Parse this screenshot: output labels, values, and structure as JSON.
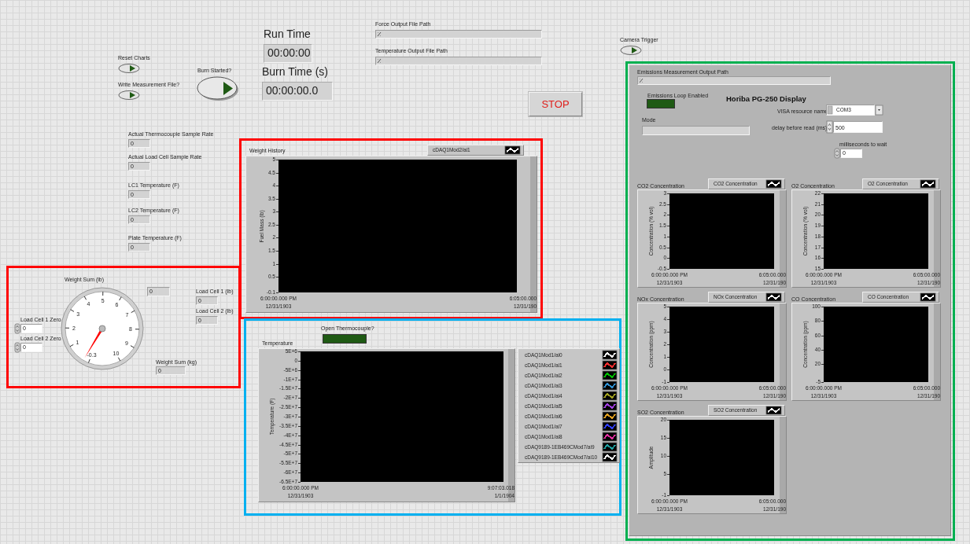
{
  "switches": [
    {
      "label": "Reset Charts",
      "on": false
    },
    {
      "label": "Write Measurement File?",
      "on": false
    },
    {
      "label": "Camera Trigger",
      "on": false
    }
  ],
  "burn_button": {
    "label": "Burn Started?",
    "on": false
  },
  "timers": [
    {
      "label": "Run Time",
      "value": "00:00:00"
    },
    {
      "label": "Burn Time (s)",
      "value": "00:00:00.0"
    }
  ],
  "file_paths": [
    {
      "label": "Force Output File Path"
    },
    {
      "label": "Temperature Output File Path"
    }
  ],
  "stop_button": "STOP",
  "indicators": [
    {
      "label": "Actual Thermocouple Sample Rate",
      "value": "0"
    },
    {
      "label": "Actual Load Cell Sample Rate",
      "value": "0"
    },
    {
      "label": "LC1 Temperature (F)",
      "value": "0"
    },
    {
      "label": "LC2 Temperature (F)",
      "value": "0"
    },
    {
      "label": "Plate Temperature (F)",
      "value": "0"
    }
  ],
  "weight_panel": {
    "gauge": {
      "label": "Weight Sum (lb)",
      "scale": [
        "-0.3",
        "1",
        "2",
        "3",
        "4",
        "5",
        "6",
        "7",
        "8",
        "9",
        "10"
      ]
    },
    "gauge_readout": "0",
    "load_cells": [
      {
        "label": "Load Cell 1 (lb)",
        "value": "0"
      },
      {
        "label": "Load Cell 2 (lb)",
        "value": "0"
      }
    ],
    "zeros": [
      {
        "label": "Load Cell 1 Zero",
        "value": "0"
      },
      {
        "label": "Load Cell 2 Zero",
        "value": "0"
      }
    ],
    "weight_kg": {
      "label": "Weight Sum (kg)",
      "value": "0"
    }
  },
  "weight_history": {
    "title": "Weight History",
    "legend": "cDAQ1Mod2/ai1",
    "ylabel": "Fuel Mass (lb)",
    "yticks": [
      "5",
      "4.5",
      "4",
      "3.5",
      "3",
      "2.5",
      "2",
      "1.5",
      "1",
      "0.5",
      "-0.1"
    ],
    "x_start": [
      "6:00:00.000 PM",
      "12/31/1903"
    ],
    "x_end": [
      "6:05:00.000",
      "12/31/190"
    ]
  },
  "open_thermocouple": {
    "label": "Open Thermocouple?",
    "on": false
  },
  "temperature_chart": {
    "title": "Temperature",
    "ylabel": "Temperature (F)",
    "yticks": [
      "5E+6",
      "0",
      "-5E+6",
      "-1E+7",
      "-1.5E+7",
      "-2E+7",
      "-2.5E+7",
      "-3E+7",
      "-3.5E+7",
      "-4E+7",
      "-4.5E+7",
      "-5E+7",
      "-5.5E+7",
      "-6E+7",
      "-6.5E+7"
    ],
    "x_start": [
      "6:00:00.000 PM",
      "12/31/1903"
    ],
    "x_end": [
      "9:07:03.018",
      "1/1/1904"
    ],
    "legend": [
      {
        "name": "cDAQ1Mod1/ai0",
        "color": "#ffffff"
      },
      {
        "name": "cDAQ1Mod1/ai1",
        "color": "#ff3030"
      },
      {
        "name": "cDAQ1Mod1/ai2",
        "color": "#00c000"
      },
      {
        "name": "cDAQ1Mod1/ai3",
        "color": "#3090d0"
      },
      {
        "name": "cDAQ1Mod1/ai4",
        "color": "#a0a020"
      },
      {
        "name": "cDAQ1Mod1/ai5",
        "color": "#a040e0"
      },
      {
        "name": "cDAQ1Mod1/ai6",
        "color": "#e0a020"
      },
      {
        "name": "cDAQ1Mod1/ai7",
        "color": "#3040ff"
      },
      {
        "name": "cDAQ1Mod1/ai8",
        "color": "#e030a0"
      },
      {
        "name": "cDAQ9189-1EB469CMod7/ai9",
        "color": "#20a0a0"
      },
      {
        "name": "cDAQ9189-1EB469CMod7/ai10",
        "color": "#ffffff"
      }
    ]
  },
  "emissions": {
    "path_label": "Emissions Measurement Output Path",
    "loop": {
      "label": "Emissions Loop Enabled",
      "on": false
    },
    "heading": "Horiba PG-250 Display",
    "mode_label": "Mode",
    "visa": {
      "label": "VISA resource name",
      "value": "COM3"
    },
    "delay": {
      "label": "delay before read (ms)",
      "value": "500"
    },
    "wait": {
      "label": "milliseconds to wait",
      "value": "0"
    },
    "charts": [
      {
        "title": "CO2 Concentration",
        "legend": "CO2 Concentration",
        "ylabel": "Concentration (% vol)",
        "yticks": [
          "3",
          "2.5",
          "2",
          "1.5",
          "1",
          "0.5",
          "0",
          "-0.5"
        ],
        "x_start": [
          "6:00:00.000 PM",
          "12/31/1903"
        ],
        "x_end": [
          "6:05:00.000",
          "12/31/190"
        ]
      },
      {
        "title": "O2 Concentration",
        "legend": "O2 Concentration",
        "ylabel": "Concentration (% vol)",
        "yticks": [
          "22",
          "21",
          "20",
          "19",
          "18",
          "17",
          "16",
          "15"
        ],
        "x_start": [
          "6:00:00.000 PM",
          "12/31/1903"
        ],
        "x_end": [
          "6:05:00.000",
          "12/31/190"
        ]
      },
      {
        "title": "NOx Concentration",
        "legend": "NOx Concentration",
        "ylabel": "Concentration (ppm)",
        "yticks": [
          "5",
          "4",
          "3",
          "2",
          "1",
          "0",
          "-1"
        ],
        "x_start": [
          "6:00:00.000 PM",
          "12/31/1903"
        ],
        "x_end": [
          "6:05:00.000",
          "12/31/190"
        ]
      },
      {
        "title": "CO Concentration",
        "legend": "CO Concentration",
        "ylabel": "Concentration (ppm)",
        "yticks": [
          "100",
          "80",
          "60",
          "40",
          "20",
          "-5"
        ],
        "x_start": [
          "6:00:00.000 PM",
          "12/31/1903"
        ],
        "x_end": [
          "6:05:00.000",
          "12/31/190"
        ]
      },
      {
        "title": "SO2 Concentration",
        "legend": "SO2 Concentration",
        "ylabel": "Amplitude",
        "yticks": [
          "20",
          "15",
          "10",
          "5",
          "-1"
        ],
        "x_start": [
          "6:00:00.000 PM",
          "12/31/1903"
        ],
        "x_end": [
          "6:05:00.000",
          "12/31/190"
        ]
      }
    ]
  }
}
